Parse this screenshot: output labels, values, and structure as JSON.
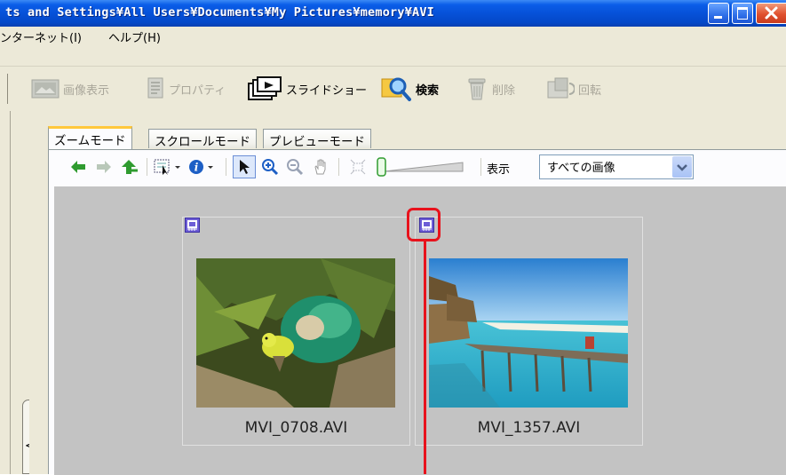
{
  "window": {
    "title": "ts and Settings¥All Users¥Documents¥My Pictures¥memory¥AVI"
  },
  "menubar": {
    "items": [
      "ンターネット(I)",
      "ヘルプ(H)"
    ]
  },
  "toolbar": {
    "items": [
      {
        "label": "画像表示",
        "icon": "image-view-icon",
        "enabled": false
      },
      {
        "label": "プロパティ",
        "icon": "properties-icon",
        "enabled": false
      },
      {
        "label": "スライドショー",
        "icon": "slideshow-icon",
        "enabled": true
      },
      {
        "label": "検索",
        "icon": "search-icon",
        "enabled": true
      },
      {
        "label": "削除",
        "icon": "trash-icon",
        "enabled": false
      },
      {
        "label": "回転",
        "icon": "rotate-icon",
        "enabled": false
      }
    ]
  },
  "tabs": [
    {
      "label": "ズームモード",
      "active": true
    },
    {
      "label": "スクロールモード",
      "active": false
    },
    {
      "label": "プレビューモード",
      "active": false
    }
  ],
  "viewtoolbar": {
    "display_label": "表示",
    "filter_value": "すべての画像",
    "icons": [
      "back-arrow-icon",
      "forward-arrow-icon",
      "up-folder-icon",
      "select-frame-icon",
      "info-icon",
      "pointer-icon",
      "zoom-in-icon",
      "zoom-out-icon",
      "pan-hand-icon",
      "fit-icon",
      "zoom-slider"
    ]
  },
  "thumbnails": [
    {
      "filename": "MVI_0708.AVI",
      "type_icon": "movie-file-icon"
    },
    {
      "filename": "MVI_1357.AVI",
      "type_icon": "movie-file-icon"
    }
  ],
  "colors": {
    "titlebar": "#0650d6",
    "chrome": "#ece9d8",
    "viewer_bg": "#c3c3c3",
    "highlight": "#e8121c",
    "active_tab_accent": "#ffc83c"
  }
}
